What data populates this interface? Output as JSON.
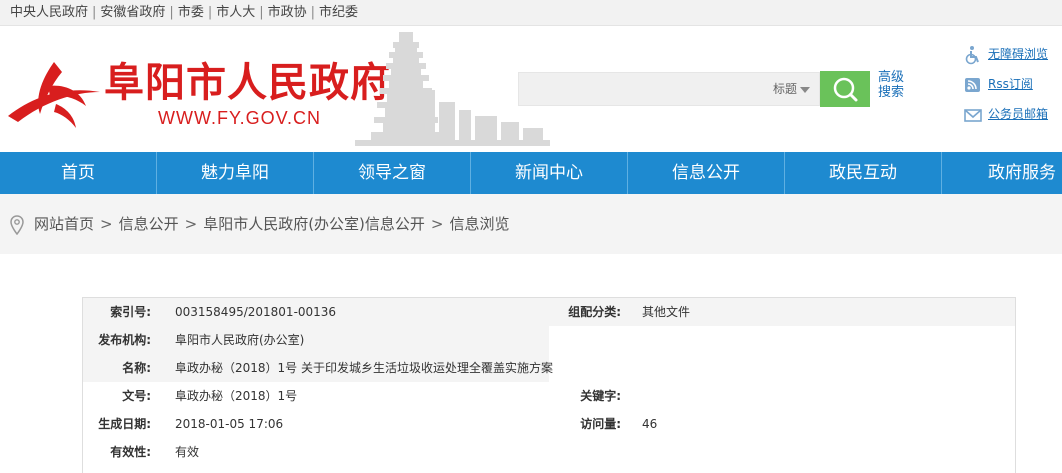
{
  "toplinks": [
    "中央人民政府",
    "安徽省政府",
    "市委",
    "市人大",
    "市政协",
    "市纪委"
  ],
  "header": {
    "title": "阜阳市人民政府",
    "url": "WWW.FY.GOV.CN"
  },
  "search": {
    "value": "",
    "scope": "标题",
    "advanced_line1": "高级",
    "advanced_line2": "搜索"
  },
  "side_links": [
    {
      "label": "无障碍浏览",
      "icon": "wheelchair-icon"
    },
    {
      "label": "Rss订阅",
      "icon": "rss-icon"
    },
    {
      "label": "公务员邮箱",
      "icon": "mail-icon"
    }
  ],
  "nav": [
    "首页",
    "魅力阜阳",
    "领导之窗",
    "新闻中心",
    "信息公开",
    "政民互动",
    "政府服务"
  ],
  "breadcrumb": [
    "网站首页",
    "信息公开",
    "阜阳市人民政府(办公室)信息公开",
    "信息浏览"
  ],
  "info": {
    "index_label": "索引号:",
    "index_value": "003158495/201801-00136",
    "category_label": "组配分类:",
    "category_value": "其他文件",
    "publisher_label": "发布机构:",
    "publisher_value": "阜阳市人民政府(办公室)",
    "name_label": "名称:",
    "name_value": "阜政办秘（2018）1号 关于印发城乡生活垃圾收运处理全覆盖实施方案",
    "docno_label": "文号:",
    "docno_value": "阜政办秘（2018）1号",
    "keyword_label": "关键字:",
    "keyword_value": "",
    "date_label": "生成日期:",
    "date_value": "2018-01-05 17:06",
    "visits_label": "访问量:",
    "visits_value": "46",
    "validity_label": "有效性:",
    "validity_value": "有效"
  },
  "colors": {
    "brand_red": "#d81e1e",
    "nav_blue": "#1e8ad0",
    "search_green": "#6ac25a",
    "link_blue": "#1a6fb8"
  }
}
